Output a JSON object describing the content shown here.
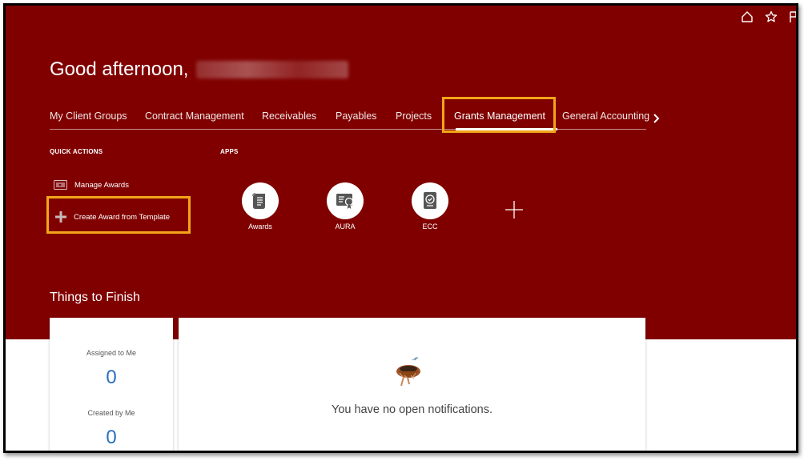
{
  "greeting": {
    "text": "Good afternoon,"
  },
  "tabs": [
    {
      "label": "My Client Groups"
    },
    {
      "label": "Contract Management"
    },
    {
      "label": "Receivables"
    },
    {
      "label": "Payables"
    },
    {
      "label": "Projects"
    },
    {
      "label": "Grants Management",
      "active": true
    },
    {
      "label": "General Accounting"
    }
  ],
  "quick_actions": {
    "title": "QUICK ACTIONS",
    "items": [
      {
        "label": "Manage Awards"
      },
      {
        "label": "Create Award from Template"
      }
    ]
  },
  "apps": {
    "title": "APPS",
    "items": [
      {
        "label": "Awards",
        "icon": "scroll-icon"
      },
      {
        "label": "AURA",
        "icon": "certificate-icon"
      },
      {
        "label": "ECC",
        "icon": "badge-document-icon"
      }
    ]
  },
  "things_to_finish": {
    "title": "Things to Finish",
    "assigned_label": "Assigned to Me",
    "assigned_count": "0",
    "created_label": "Created by Me",
    "created_count": "0",
    "empty_message": "You have no open notifications."
  },
  "colors": {
    "hero_bg": "#800000",
    "highlight": "#F3A51A",
    "count": "#2a6ebd"
  }
}
